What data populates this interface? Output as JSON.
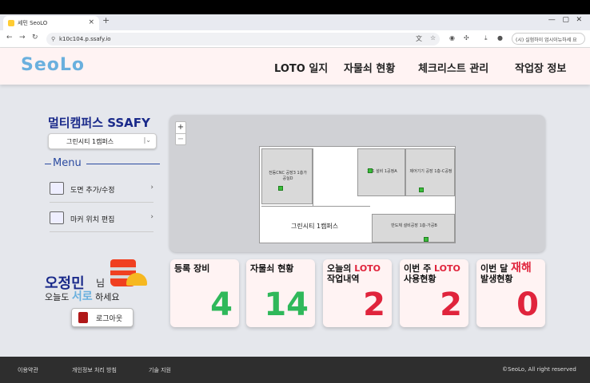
{
  "browser": {
    "tab_title": "세민 SeoLO",
    "url": "k10c104.p.ssafy.io",
    "profile": "(시) 실험하이 업시이뉴하세 요"
  },
  "header": {
    "logo": "SeoLo",
    "menu": [
      "LOTO 일지",
      "자물쇠 현황",
      "체크리스트 관리",
      "작업장 정보"
    ]
  },
  "sidebar": {
    "campus": "멀티캠퍼스 SSAFY",
    "campus_select": "그린시티 1캠퍼스",
    "menu_title": "Menu",
    "items": [
      {
        "label": "도면 추가/수정",
        "icon": "blueprint-icon"
      },
      {
        "label": "마커 위치 편집",
        "icon": "notebook-icon"
      }
    ]
  },
  "map": {
    "floor_label": "그린시티 1캠퍼스",
    "rooms": [
      "전동CNC 공장3 1층가공실D",
      "제조 설비 1공정A",
      "제어기기 공장 1층-C공정",
      "반도체 설비공장 1층-가공B"
    ]
  },
  "user": {
    "name": "오정민",
    "suffix": "님",
    "greet_pre": "오늘도",
    "greet_mid": "서로",
    "greet_post": "하세요",
    "logout": "로그아웃"
  },
  "cards": [
    {
      "t1": "등록 장비",
      "t1red": "",
      "t2": "",
      "value": "4",
      "color": "green"
    },
    {
      "t1": "자물쇠 현황",
      "t1red": "",
      "t2": "",
      "value": "14",
      "color": "green"
    },
    {
      "t1": "오늘의 ",
      "t1red": "LOTO",
      "t2": "작업내역",
      "value": "2",
      "color": "red"
    },
    {
      "t1": "이번 주 ",
      "t1red": "LOTO",
      "t2": "사용현황",
      "value": "2",
      "color": "red"
    },
    {
      "t1": "이번 달 ",
      "t1red": "재해",
      "t2": "발생현황",
      "value": "0",
      "color": "red"
    }
  ],
  "footer": {
    "links": [
      "이용약관",
      "개인정보 처리 방침",
      "기술 지원"
    ],
    "copyright": "©SeoLo, All right reserved"
  }
}
